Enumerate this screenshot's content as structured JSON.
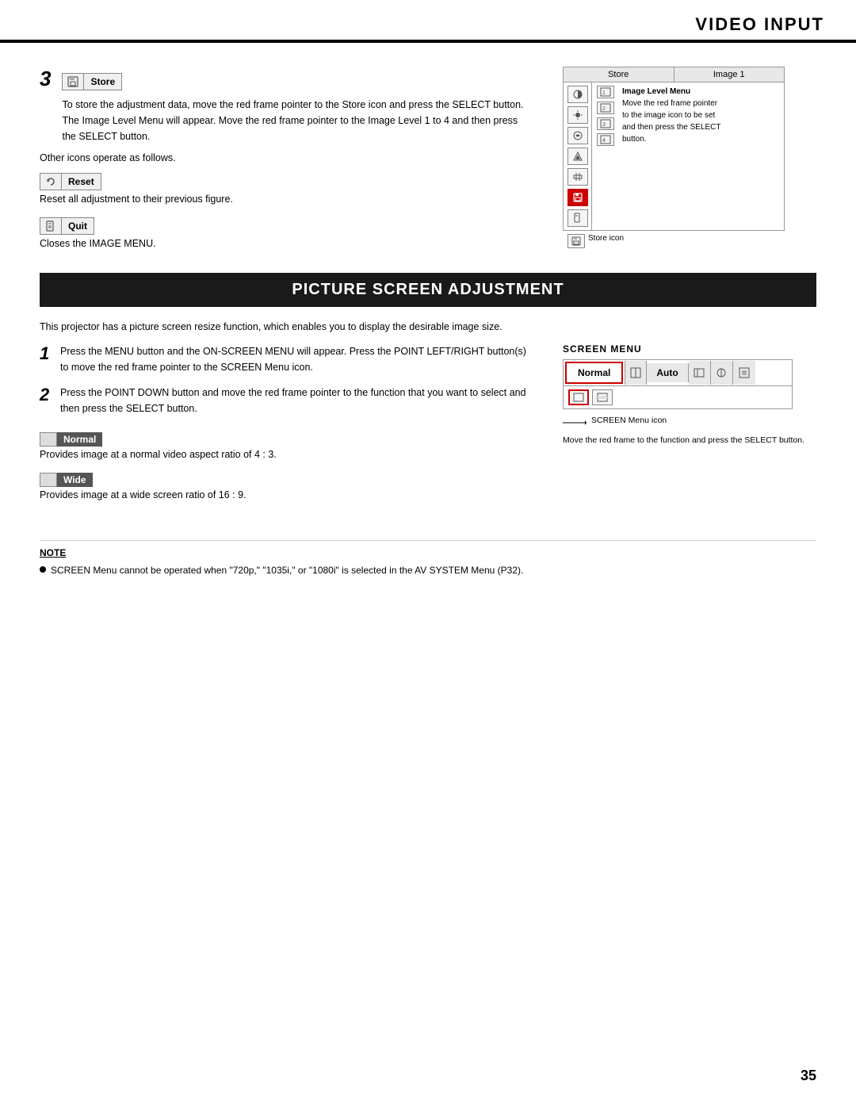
{
  "header": {
    "title": "VIDEO INPUT"
  },
  "section3": {
    "step_number": "3",
    "store_icon_label": "Store",
    "store_description": "To store the adjustment data, move the red frame pointer to the Store icon and press the SELECT button.  The Image Level Menu will appear.  Move the red frame pointer to the Image Level 1 to 4 and then press the SELECT button.",
    "other_icons_label": "Other icons operate as follows.",
    "reset_icon_label": "Reset",
    "reset_description": "Reset all adjustment to their previous figure.",
    "quit_icon_label": "Quit",
    "quit_description": "Closes the IMAGE MENU.",
    "diagram": {
      "col1_header": "Store",
      "col2_header": "Image 1",
      "icons": [
        "●",
        "✳",
        "◑",
        "●",
        "▼",
        "↺",
        "⚙"
      ],
      "image_levels": [
        "□1",
        "□2",
        "□3",
        "□4"
      ],
      "store_icon_label": "Store icon",
      "annotation": {
        "title": "Image Level Menu",
        "line1": "Move the red frame pointer",
        "line2": "to the image icon to be set",
        "line3": "and then press the SELECT",
        "line4": "button."
      }
    }
  },
  "psa": {
    "title": "PICTURE SCREEN ADJUSTMENT",
    "intro": "This projector has a picture screen resize function, which enables you to display the desirable image size.",
    "step1": {
      "number": "1",
      "text": "Press the MENU button and the ON-SCREEN MENU will appear.  Press the POINT LEFT/RIGHT button(s) to move the red frame pointer to the SCREEN Menu icon."
    },
    "step2": {
      "number": "2",
      "text": "Press the POINT DOWN button and move the red frame pointer to the function that you want to select and then press the SELECT button."
    },
    "normal_label": "Normal",
    "normal_description": "Provides image at a normal video aspect ratio of 4 : 3.",
    "wide_label": "Wide",
    "wide_description": "Provides image at a wide screen ratio of 16 : 9.",
    "screen_menu": {
      "label": "SCREEN MENU",
      "normal_text": "Normal",
      "auto_text": "Auto",
      "screen_menu_icon_label": "SCREEN Menu icon",
      "move_text": "Move the red frame to the function and press the SELECT button."
    }
  },
  "note": {
    "title": "NOTE",
    "items": [
      "SCREEN Menu cannot be operated when \"720p,\" \"1035i,\" or \"1080i\" is selected in the AV SYSTEM Menu (P32)."
    ]
  },
  "page_number": "35"
}
